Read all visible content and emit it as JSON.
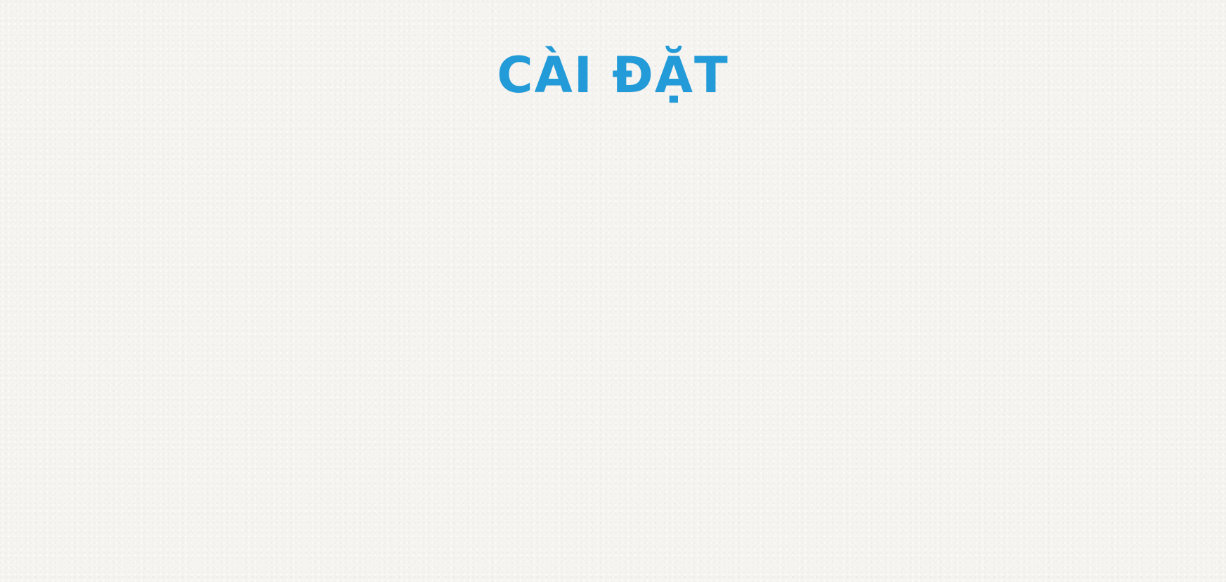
{
  "screen": {
    "title": "CÀI ĐẶT"
  },
  "colors": {
    "background": "#f6f4f1",
    "title": "#229bd8"
  }
}
